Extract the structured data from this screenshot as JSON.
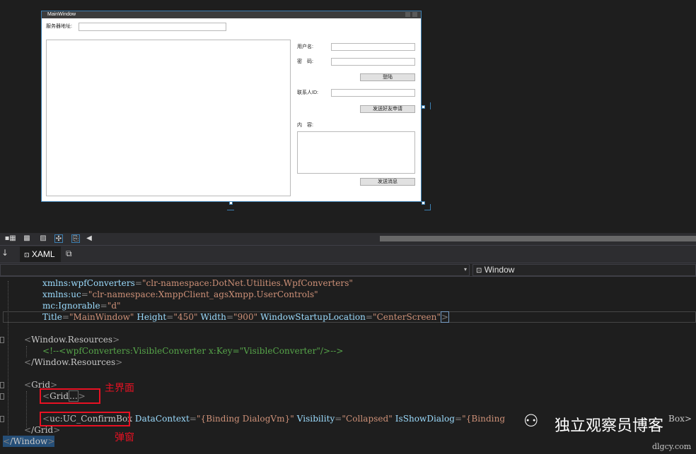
{
  "designer": {
    "window_title": "MainWindow",
    "server_label": "服务器地址:",
    "username_label": "用户名:",
    "password_label": "密　码:",
    "login_button": "登陆",
    "contact_label": "联系人ID:",
    "send_request_button": "发送好友申请",
    "content_label": "内　容:",
    "send_message_button": "发送消息"
  },
  "editor": {
    "tab_label": "XAML",
    "nav_right": "Window",
    "lines": {
      "l1_attr": "xmlns:wpfConverters",
      "l1_val": "\"clr-namespace:DotNet.Utilities.WpfConverters\"",
      "l2_attr": "xmlns:uc",
      "l2_val": "\"clr-namespace:XmppClient_agsXmpp.UserControls\"",
      "l3_attr": "mc:Ignorable",
      "l3_val": "\"d\"",
      "l4_a1": "Title",
      "l4_v1": "\"MainWindow\"",
      "l4_a2": "Height",
      "l4_v2": "\"450\"",
      "l4_a3": "Width",
      "l4_v3": "\"900\"",
      "l4_a4": "WindowStartupLocation",
      "l4_v4": "\"CenterScreen\"",
      "l5": "Window.Resources",
      "l6_comment": "<!--<wpfConverters:VisibleConverter x:Key=\"VisibleConverter\"/>-->",
      "l7": "/Window.Resources",
      "l8": "Grid",
      "l9": "Grid",
      "l9_collapsed": "...",
      "l10_el": "uc:UC_ConfirmBox",
      "l10_a1": "DataContext",
      "l10_v1": "\"{Binding DialogVm}\"",
      "l10_a2": "Visibility",
      "l10_v2": "\"Collapsed\"",
      "l10_a3": "IsShowDialog",
      "l10_v3": "\"{Binding ",
      "l10_tail": "Box>",
      "l11": "/Grid",
      "l12": "/Window"
    }
  },
  "annotations": {
    "main_ui": "主界面",
    "popup": "弹窗"
  },
  "watermark": {
    "brand": "独立观察员博客",
    "url": "dlgcy.com"
  }
}
